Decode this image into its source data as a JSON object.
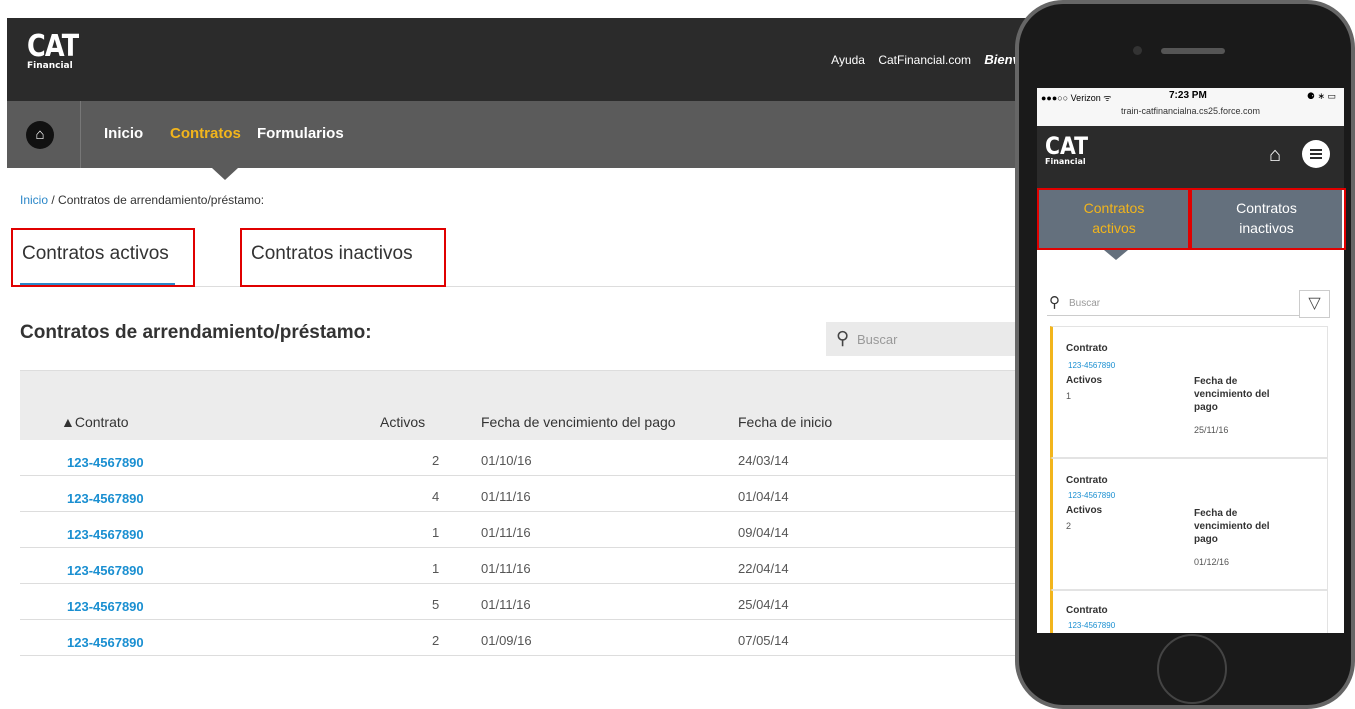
{
  "desktop": {
    "header": {
      "logo_text": "CAT",
      "logo_sub": "Financial",
      "links": [
        "Ayuda",
        "CatFinancial.com"
      ],
      "welcome": "Bienve"
    },
    "nav": {
      "items": [
        "Inicio",
        "Contratos",
        "Formularios"
      ],
      "active": "Contratos"
    },
    "breadcrumb": {
      "home": "Inicio",
      "separator": " / ",
      "current": "Contratos de arrendamiento/préstamo:"
    },
    "tabs": [
      "Contratos activos",
      "Contratos inactivos"
    ],
    "section_title": "Contratos de arrendamiento/préstamo:",
    "search_placeholder": "Buscar",
    "table": {
      "headers": [
        "▲Contrato",
        "Activos",
        "Fecha de vencimiento del pago",
        "Fecha de inicio"
      ],
      "rows": [
        {
          "contract": "123-4567890",
          "assets": "2",
          "due": "01/10/16",
          "start": "24/03/14"
        },
        {
          "contract": "123-4567890",
          "assets": "4",
          "due": "01/11/16",
          "start": "01/04/14"
        },
        {
          "contract": "123-4567890",
          "assets": "1",
          "due": "01/11/16",
          "start": "09/04/14"
        },
        {
          "contract": "123-4567890",
          "assets": "1",
          "due": "01/11/16",
          "start": "22/04/14"
        },
        {
          "contract": "123-4567890",
          "assets": "5",
          "due": "01/11/16",
          "start": "25/04/14"
        },
        {
          "contract": "123-4567890",
          "assets": "2",
          "due": "01/09/16",
          "start": "07/05/14"
        }
      ]
    }
  },
  "mobile": {
    "status": {
      "carrier": "●●●○○ Verizon ᯤ",
      "time": "7:23 PM",
      "battery": "⚈ ∗ ▭",
      "url": "train-catfinancialna.cs25.force.com"
    },
    "logo_text": "CAT",
    "logo_sub": "Financial",
    "tabs": [
      "Contratos activos",
      "Contratos inactivos"
    ],
    "search_placeholder": "Buscar",
    "cards": [
      {
        "contract_label": "Contrato",
        "contract": "123-4567890",
        "assets_label": "Activos",
        "assets": "1",
        "due_label": "Fecha de vencimiento del pago",
        "due": "25/11/16"
      },
      {
        "contract_label": "Contrato",
        "contract": "123-4567890",
        "assets_label": "Activos",
        "assets": "2",
        "due_label": "Fecha de vencimiento del pago",
        "due": "01/12/16"
      },
      {
        "contract_label": "Contrato",
        "contract": "123-4567890"
      }
    ]
  },
  "colors": {
    "accent": "#f2b51c",
    "link": "#1a8fd1",
    "highlight": "#e00000"
  }
}
